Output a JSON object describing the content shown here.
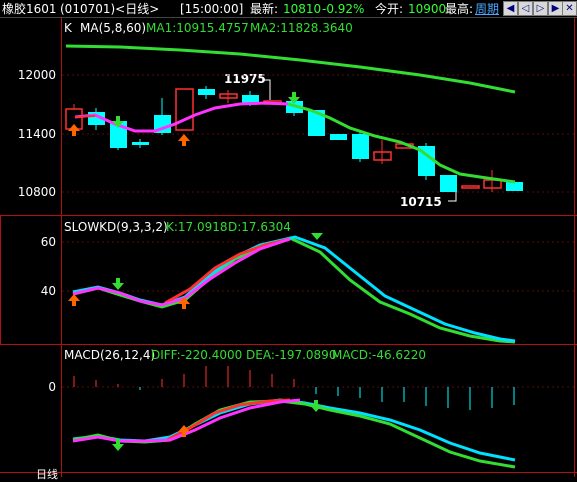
{
  "titlebar": {
    "symbol": "橡胶1601",
    "code_period": "(010701)<日线>",
    "time": "[15:00:00]",
    "latest_label": "最新:",
    "latest_value": "10810",
    "change_pct": "-0.92%",
    "open_label": "今开:",
    "open_value": "10900",
    "high_label": "最高:",
    "weekly_link": "周期",
    "nav_buttons": [
      "first-icon",
      "prev-icon",
      "next-icon",
      "last-icon",
      "close-icon"
    ]
  },
  "kline": {
    "k_label": "K",
    "ma_label": "MA(5,8,60)",
    "ma1_text": "MA1:10915.4757",
    "ma2_text": "MA2:11828.3640",
    "annotation_high": "11975",
    "annotation_low": "10715",
    "y_ticks": [
      "12000",
      "11400",
      "10800"
    ]
  },
  "slowkd": {
    "name": "SLOWKD(9,3,3,2)",
    "k_text": "K:17.0918",
    "d_text": "D:17.6304",
    "y_ticks": [
      "60",
      "40"
    ]
  },
  "macd": {
    "name": "MACD(26,12,4)",
    "diff_text": "DIFF:-220.4000",
    "dea_text": "DEA:-197.0890",
    "macd_text": "MACD:-46.6220",
    "y_ticks": [
      "0"
    ]
  },
  "bottom": {
    "label": "日线"
  },
  "colors": {
    "up_candle": "#ff3030",
    "down_candle": "#00ffff",
    "ma_long": "#33dd33",
    "ma_short": "#ff33ff",
    "kd_k": "#00e0ff",
    "diff": "#33dd33",
    "dea": "#ff33ff"
  }
}
